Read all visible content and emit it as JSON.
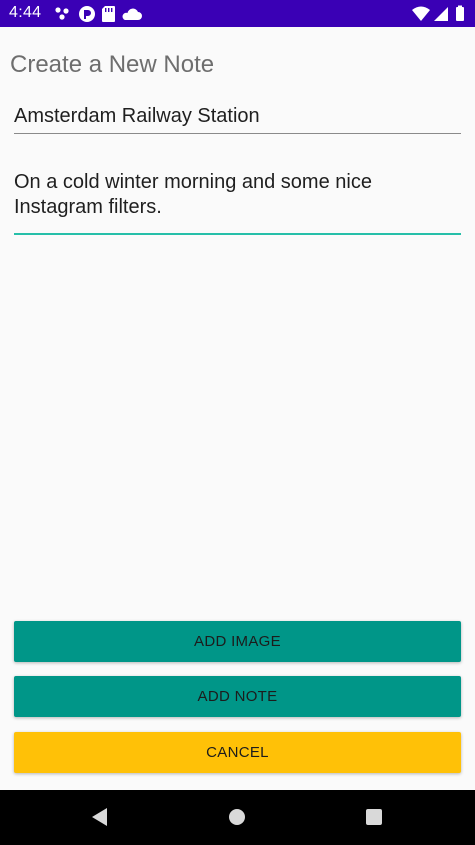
{
  "status_bar": {
    "time": "4:44",
    "background_color": "#3a00b5",
    "left_icons": [
      "notification-dots-icon",
      "app-badge-icon",
      "sd-card-icon",
      "cloud-icon"
    ],
    "right_icons": [
      "wifi-icon",
      "cellular-signal-icon",
      "battery-icon"
    ]
  },
  "screen": {
    "title": "Create a New Note"
  },
  "form": {
    "title_value": "Amsterdam Railway Station",
    "body_value": "On a cold winter morning and some nice Instagram filters.",
    "focus_color": "#26bfa9"
  },
  "buttons": {
    "add_image": "ADD IMAGE",
    "add_note": "ADD NOTE",
    "cancel": "CANCEL",
    "primary_color": "#009688",
    "cancel_color": "#ffc107"
  },
  "nav_bar": {
    "icons": [
      "back-icon",
      "home-icon",
      "recents-icon"
    ]
  }
}
